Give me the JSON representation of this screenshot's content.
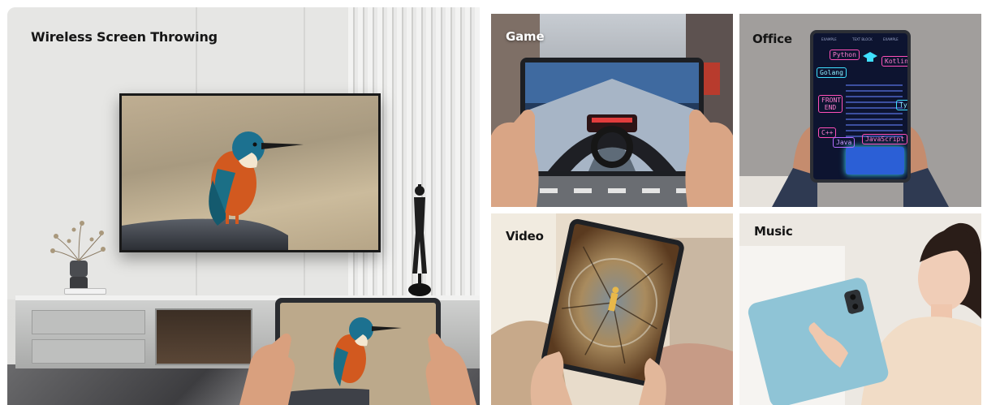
{
  "panels": {
    "living": {
      "label": "Wireless Screen Throwing"
    },
    "game": {
      "label": "Game"
    },
    "office": {
      "label": "Office",
      "screen_headers": [
        "EXAMPLE",
        "TEXT BLOCK",
        "EXAMPLE"
      ],
      "code_words": [
        "Python",
        "Kotlin",
        "Golang",
        "FRONT END",
        "Ty",
        "C++",
        "Java",
        "JavaScript"
      ]
    },
    "video": {
      "label": "Video"
    },
    "music": {
      "label": "Music"
    }
  },
  "colors": {
    "office_accent_pink": "#ff4fb8",
    "office_accent_cyan": "#3fe0ff",
    "office_accent_violet": "#b46bff",
    "tablet_blue": "#8fc4d6"
  }
}
